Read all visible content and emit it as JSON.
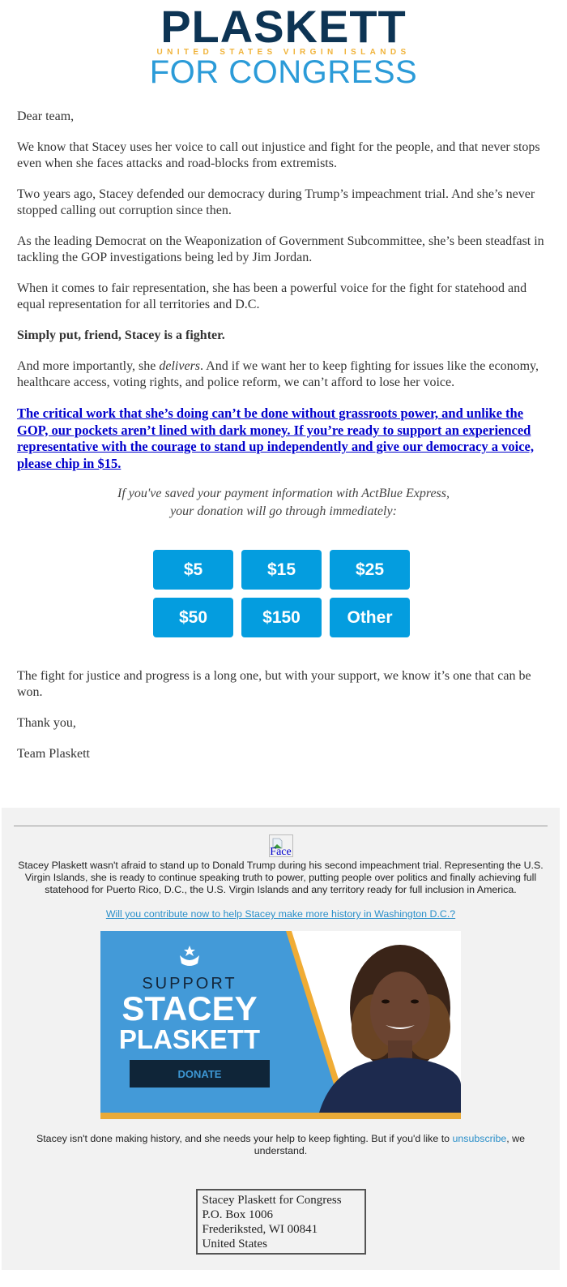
{
  "header": {
    "logo_line1": "PLASKETT",
    "logo_line2": "UNITED STATES VIRGIN ISLANDS",
    "logo_line3": "FOR CONGRESS"
  },
  "letter": {
    "greeting": "Dear team,",
    "paragraphs": [
      "We know that Stacey uses her voice to call out injustice and fight for the people, and that never stops even when she faces attacks and road-blocks from extremists.",
      "Two years ago, Stacey defended our democracy during Trump’s impeachment trial. And she’s never stopped calling out corruption since then.",
      "As the leading Democrat on the Weaponization of Government Subcommittee, she’s been steadfast in tackling the GOP investigations being led by Jim Jordan.",
      "When it comes to fair representation, she has been a powerful voice for the fight for statehood and equal representation for all territories and D.C."
    ],
    "bold_line": "Simply put, friend, Stacey is a fighter.",
    "delivers_before": "And more importantly, she ",
    "delivers_em": "delivers",
    "delivers_after": ". And if we want her to keep fighting for issues like the economy, healthcare access, voting rights, and police reform, we can’t afford to lose her voice.",
    "cta_link": "The critical work that she’s doing can’t be done without grassroots power, and unlike the GOP, our pockets aren’t lined with dark money. If you’re ready to support an experienced representative with the courage to stand up independently and give our democracy a voice, please chip in $15.",
    "express_line1": "If you've saved your payment information with ActBlue Express,",
    "express_line2": "your donation will go through immediately:"
  },
  "donate_buttons": [
    "$5",
    "$15",
    "$25",
    "$50",
    "$150",
    "Other"
  ],
  "closing": {
    "paragraph": "The fight for justice and progress is a long one, but with your support, we know it’s one that can be won.",
    "thanks": "Thank you,",
    "signature": "Team Plaskett"
  },
  "footer": {
    "image_alt": "Face",
    "blurb": "Stacey Plaskett wasn't afraid to stand up to Donald Trump during his second impeachment trial. Representing the U.S. Virgin Islands, she is ready to continue speaking truth to power, putting people over politics and finally achieving full statehood for Puerto Rico, D.C., the U.S. Virgin Islands and any territory ready for full inclusion in America.",
    "contribute_link": "Will you contribute now to help Stacey make more history in Washington D.C.?",
    "banner": {
      "support": "SUPPORT",
      "name1": "STACEY",
      "name2": "PLASKETT",
      "donate": "DONATE"
    },
    "unsub_before": "Stacey isn't done making history, and she needs your help to keep fighting. But if you'd like to ",
    "unsub_link": "unsubscribe",
    "unsub_after": ", we understand.",
    "address": [
      "Stacey Plaskett for Congress",
      "P.O. Box 1006",
      "Frederiksted, WI 00841",
      "United States"
    ]
  },
  "colors": {
    "donate_button": "#049ddf",
    "logo_navy": "#0d3454",
    "logo_gold": "#f0b33a",
    "logo_blue": "#2b9bd8",
    "link_blue": "#0000cc",
    "footer_link": "#2a8fc9",
    "footer_bg": "#f2f2f2"
  }
}
